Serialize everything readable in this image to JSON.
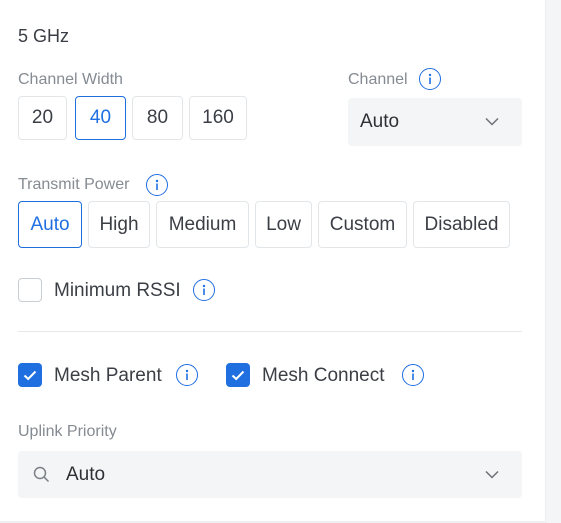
{
  "band": {
    "title": "5 GHz"
  },
  "channel_width": {
    "label": "Channel Width",
    "options": [
      "20",
      "40",
      "80",
      "160"
    ],
    "selected": "40"
  },
  "channel": {
    "label": "Channel",
    "info_icon": "info-icon",
    "value": "Auto"
  },
  "transmit_power": {
    "label": "Transmit Power",
    "info_icon": "info-icon",
    "options": [
      "Auto",
      "High",
      "Medium",
      "Low",
      "Custom",
      "Disabled"
    ],
    "selected": "Auto"
  },
  "minimum_rssi": {
    "label": "Minimum RSSI",
    "checked": false
  },
  "mesh_parent": {
    "label": "Mesh Parent",
    "checked": true
  },
  "mesh_connect": {
    "label": "Mesh Connect",
    "checked": true
  },
  "uplink_priority": {
    "label": "Uplink Priority",
    "value": "Auto",
    "search_icon": "search-icon"
  },
  "colors": {
    "accent": "#1f6fe0",
    "muted_text": "#858b92",
    "field_bg": "#f4f5f6"
  }
}
